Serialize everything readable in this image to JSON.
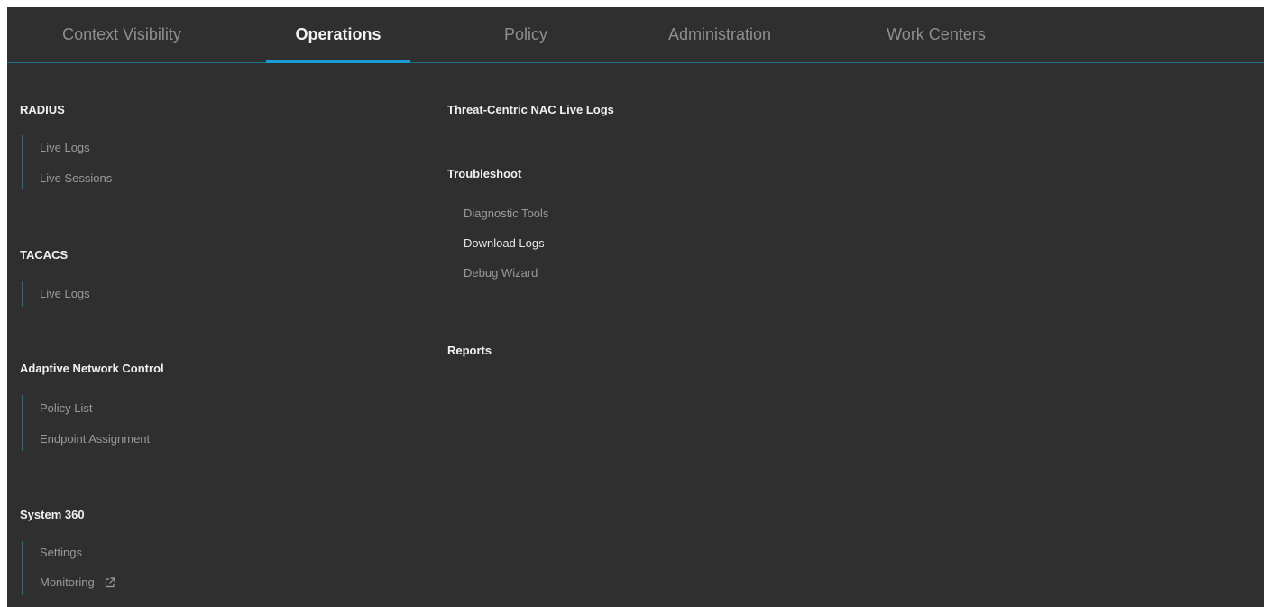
{
  "nav": {
    "tabs": [
      {
        "label": "Context Visibility",
        "active": false
      },
      {
        "label": "Operations",
        "active": true
      },
      {
        "label": "Policy",
        "active": false
      },
      {
        "label": "Administration",
        "active": false
      },
      {
        "label": "Work Centers",
        "active": false
      }
    ]
  },
  "menu": {
    "radius": {
      "title": "RADIUS",
      "items": [
        "Live Logs",
        "Live Sessions"
      ]
    },
    "tacacs": {
      "title": "TACACS",
      "items": [
        "Live Logs"
      ]
    },
    "anc": {
      "title": "Adaptive Network Control",
      "items": [
        "Policy List",
        "Endpoint Assignment"
      ]
    },
    "system360": {
      "title": "System 360",
      "items": [
        "Settings",
        "Monitoring"
      ]
    },
    "threat": {
      "title": "Threat-Centric NAC Live Logs"
    },
    "troubleshoot": {
      "title": "Troubleshoot",
      "items": [
        "Diagnostic Tools",
        "Download Logs",
        "Debug Wizard"
      ]
    },
    "reports": {
      "title": "Reports"
    }
  },
  "icons": {
    "external_link": "external-link-icon"
  },
  "colors": {
    "background": "#2f2f2f",
    "accent": "#1a9bd7",
    "divider": "#1e6f8e",
    "active_text": "#f2f2f2",
    "muted_text": "#9a9a9a"
  }
}
